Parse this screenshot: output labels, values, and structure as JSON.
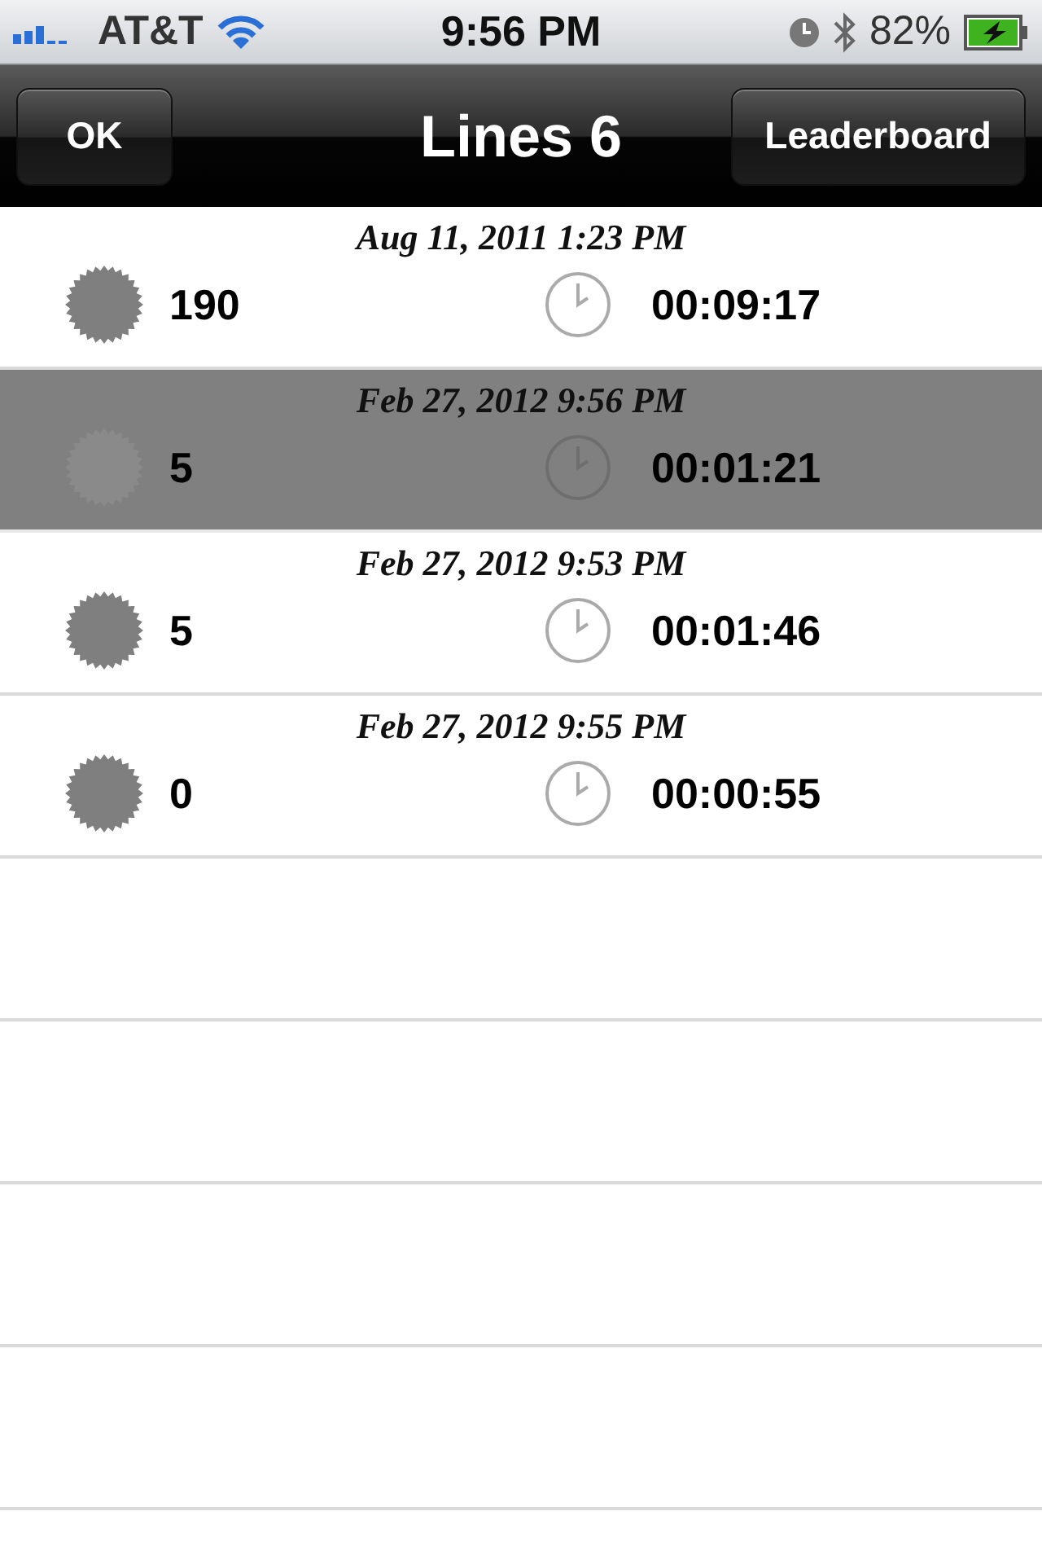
{
  "status_bar": {
    "carrier": "AT&T",
    "time": "9:56 PM",
    "battery": "82%"
  },
  "nav": {
    "left_button": "OK",
    "title": "Lines 6",
    "right_button": "Leaderboard"
  },
  "rows": [
    {
      "date": "Aug 11, 2011 1:23 PM",
      "score": "190",
      "duration": "00:09:17",
      "selected": false
    },
    {
      "date": "Feb 27, 2012 9:56 PM",
      "score": "5",
      "duration": "00:01:21",
      "selected": true
    },
    {
      "date": "Feb 27, 2012 9:53 PM",
      "score": "5",
      "duration": "00:01:46",
      "selected": false
    },
    {
      "date": "Feb 27, 2012 9:55 PM",
      "score": "0",
      "duration": "00:00:55",
      "selected": false
    }
  ]
}
